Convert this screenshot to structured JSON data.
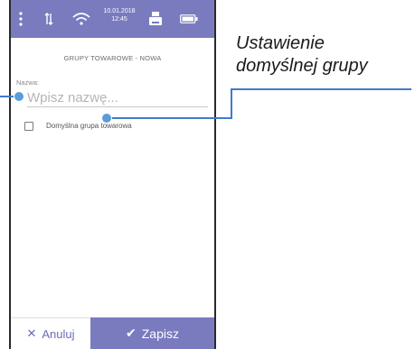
{
  "status_bar": {
    "date": "10.01.2018",
    "time": "12:45",
    "icons": [
      "menu-dots-icon",
      "data-arrows-icon",
      "wifi-icon",
      "printer-icon",
      "battery-icon"
    ]
  },
  "screen": {
    "title": "GRUPY TOWAROWE - NOWA",
    "name_field": {
      "label": "Nazwa:",
      "placeholder": "Wpisz nazwę..."
    },
    "default_group_checkbox": {
      "label": "Domyślna grupa towarowa",
      "checked": false
    }
  },
  "bottom_bar": {
    "cancel_label": "Anuluj",
    "save_label": "Zapisz"
  },
  "annotation": {
    "line1": "Ustawienie",
    "line2": "domyślnej grupy"
  },
  "colors": {
    "accent": "#7a7bbf",
    "callout": "#3d7cc9"
  }
}
